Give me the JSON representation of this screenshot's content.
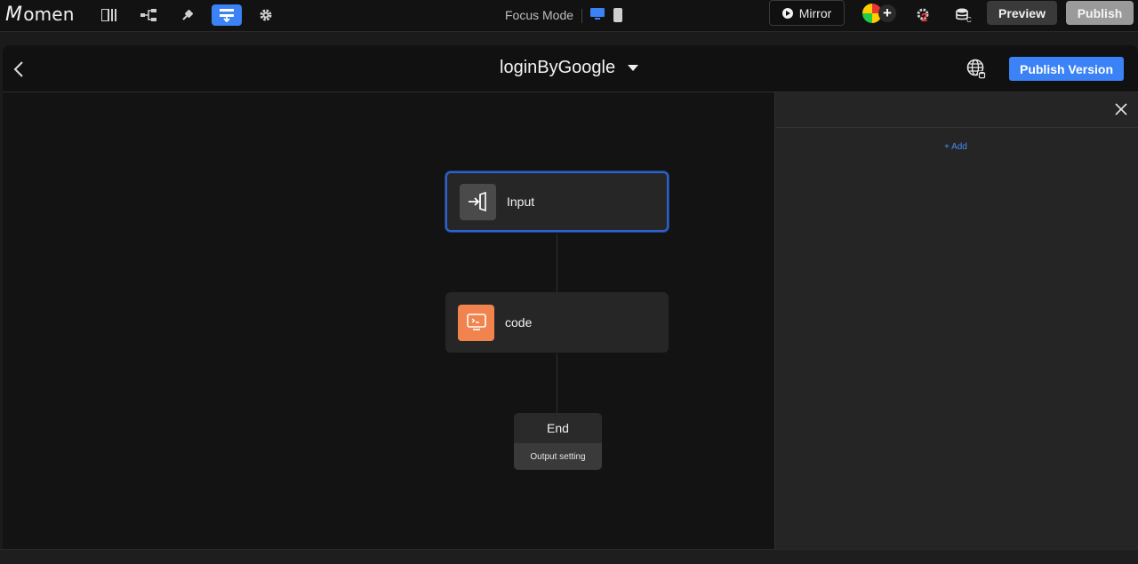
{
  "topbar": {
    "logo_text": "omen",
    "logo_initial": "M",
    "focus_mode_label": "Focus Mode",
    "mirror_label": "Mirror",
    "notification_count": "2",
    "preview_label": "Preview",
    "publish_label": "Publish",
    "accent_color": "#3b82f6"
  },
  "modal": {
    "title": "loginByGoogle",
    "publish_version_label": "Publish Version"
  },
  "flow": {
    "nodes": [
      {
        "label": "Input",
        "icon": "input-icon",
        "icon_color": "#4a4a4a"
      },
      {
        "label": "code",
        "icon": "code-terminal-icon",
        "icon_color": "#f0834e"
      }
    ],
    "end": {
      "label": "End",
      "sub_label": "Output setting"
    }
  },
  "panel": {
    "add_label": "+ Add"
  }
}
